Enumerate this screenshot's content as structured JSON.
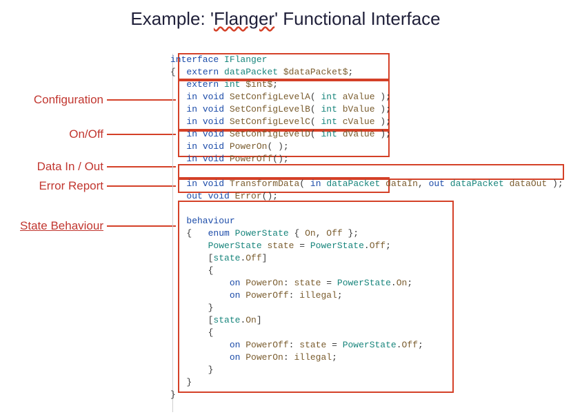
{
  "title": {
    "prefix": "Example: '",
    "flanger": "Flanger",
    "suffix": "' Functional Interface"
  },
  "labels": {
    "configuration": "Configuration",
    "onoff": "On/Off",
    "dataio": "Data In / Out",
    "error": "Error Report",
    "behaviour": "State Behaviour"
  },
  "annotation_colors": {
    "label": "#c1362f",
    "box_border": "#d44027"
  },
  "code": {
    "interface_kw": "interface",
    "interface_name": "IFlanger",
    "open_brace": "{",
    "close_brace": "}",
    "extern1": {
      "kw": "extern",
      "type": "dataPacket",
      "name": "$dataPacket$",
      "semi": ";"
    },
    "extern2": {
      "kw": "extern",
      "type": "int",
      "name": "$int$",
      "semi": ";"
    },
    "setA": {
      "dir": "in",
      "void": "void",
      "fn": "SetConfigLevelA",
      "sig_open": "( ",
      "argtype": "int",
      "argname": "aValue",
      "sig_close": " );"
    },
    "setB": {
      "dir": "in",
      "void": "void",
      "fn": "SetConfigLevelB",
      "sig_open": "( ",
      "argtype": "int",
      "argname": "bValue",
      "sig_close": " );"
    },
    "setC": {
      "dir": "in",
      "void": "void",
      "fn": "SetConfigLevelC",
      "sig_open": "( ",
      "argtype": "int",
      "argname": "cValue",
      "sig_close": " );"
    },
    "setD": {
      "dir": "in",
      "void": "void",
      "fn": "SetConfigLevelD",
      "sig_open": "( ",
      "argtype": "int",
      "argname": "dValue",
      "sig_close": " );"
    },
    "powerOn": {
      "dir": "in",
      "void": "void",
      "fn": "PowerOn",
      "sig": "( );"
    },
    "powerOff": {
      "dir": "in",
      "void": "void",
      "fn": "PowerOff",
      "sig": "();"
    },
    "transform": {
      "dir": "in",
      "void": "void",
      "fn": "TransformData",
      "open": "( ",
      "in_kw": "in",
      "type1": "dataPacket",
      "arg1": "dataIn",
      "comma": ", ",
      "out_kw": "out",
      "type2": "dataPacket",
      "arg2": "dataOut",
      "close": " );"
    },
    "error": {
      "dir": "out",
      "void": "void",
      "fn": "Error",
      "sig": "();"
    },
    "behaviour_kw": "behaviour",
    "enum_line": {
      "open": "{   ",
      "enum_kw": "enum",
      "enum_name": "PowerState",
      "body_open": " { ",
      "on": "On",
      "comma": ", ",
      "off": "Off",
      "body_close": " };"
    },
    "state_decl": {
      "indent": "    ",
      "type": "PowerState",
      "name": "state",
      "eq": " = ",
      "val_type": "PowerState",
      "dot": ".",
      "val": "Off",
      "semi": ";"
    },
    "guard_off": {
      "indent": "    [",
      "type": "state",
      "dot": ".",
      "val": "Off",
      "close": "]"
    },
    "brace_open_ind": "    {",
    "brace_close_ind": "    }",
    "on_poweron_setOn": {
      "indent": "        ",
      "on_kw": "on",
      "evt": "PowerOn",
      "colon": ": ",
      "lhs": "state",
      "eq": " = ",
      "rtype": "PowerState",
      "dot": ".",
      "rval": "On",
      "semi": ";"
    },
    "on_poweroff_ill": {
      "indent": "        ",
      "on_kw": "on",
      "evt": "PowerOff",
      "colon": ": ",
      "illegal": "illegal",
      "semi": ";"
    },
    "guard_on": {
      "indent": "    [",
      "type": "state",
      "dot": ".",
      "val": "On",
      "close": "]"
    },
    "on_poweroff_setOff": {
      "indent": "        ",
      "on_kw": "on",
      "evt": "PowerOff",
      "colon": ": ",
      "lhs": "state",
      "eq": " = ",
      "rtype": "PowerState",
      "dot": ".",
      "rval": "Off",
      "semi": ";"
    },
    "on_poweron_ill": {
      "indent": "        ",
      "on_kw": "on",
      "evt": "PowerOn",
      "colon": ": ",
      "illegal": "illegal",
      "semi": ";"
    }
  }
}
